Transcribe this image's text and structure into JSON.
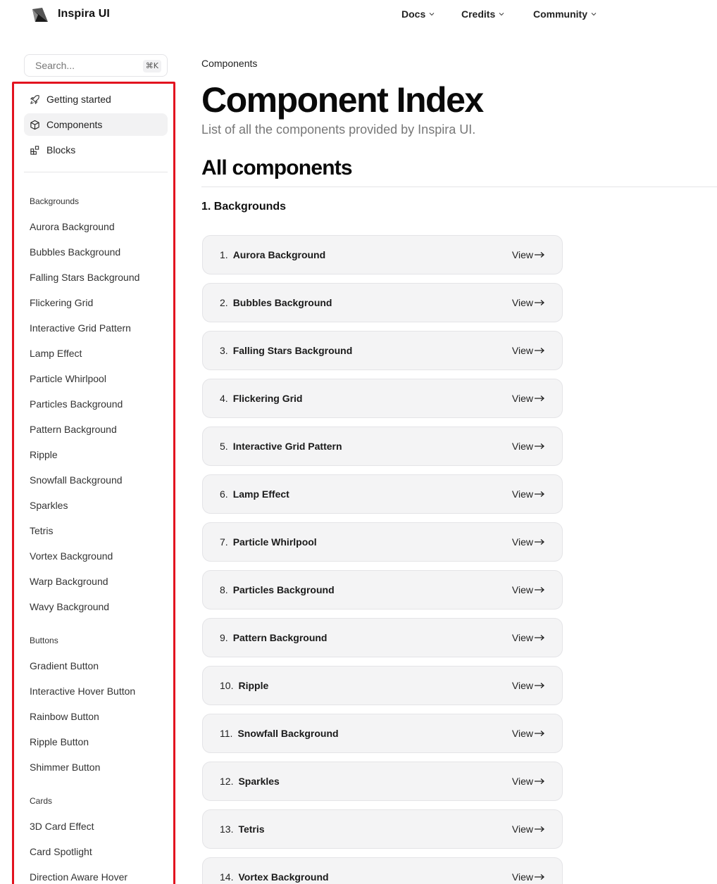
{
  "header": {
    "brand": "Inspira UI",
    "nav": [
      {
        "label": "Docs"
      },
      {
        "label": "Credits"
      },
      {
        "label": "Community"
      }
    ]
  },
  "sidebar": {
    "search": {
      "placeholder": "Search...",
      "shortcut": "⌘K"
    },
    "top_links": [
      {
        "label": "Getting started",
        "icon": "rocket-icon",
        "active": false
      },
      {
        "label": "Components",
        "icon": "cube-icon",
        "active": true
      },
      {
        "label": "Blocks",
        "icon": "blocks-icon",
        "active": false
      }
    ],
    "groups": [
      {
        "title": "Backgrounds",
        "items": [
          "Aurora Background",
          "Bubbles Background",
          "Falling Stars Background",
          "Flickering Grid",
          "Interactive Grid Pattern",
          "Lamp Effect",
          "Particle Whirlpool",
          "Particles Background",
          "Pattern Background",
          "Ripple",
          "Snowfall Background",
          "Sparkles",
          "Tetris",
          "Vortex Background",
          "Warp Background",
          "Wavy Background"
        ]
      },
      {
        "title": "Buttons",
        "items": [
          "Gradient Button",
          "Interactive Hover Button",
          "Rainbow Button",
          "Ripple Button",
          "Shimmer Button"
        ]
      },
      {
        "title": "Cards",
        "items": [
          "3D Card Effect",
          "Card Spotlight",
          "Direction Aware Hover"
        ]
      }
    ]
  },
  "main": {
    "breadcrumb": "Components",
    "title": "Component Index",
    "subtitle": "List of all the components provided by Inspira UI.",
    "section_title": "All components",
    "subsection_title": "1. Backgrounds",
    "view_label": "View",
    "components": [
      {
        "num": "1.",
        "name": "Aurora Background"
      },
      {
        "num": "2.",
        "name": "Bubbles Background"
      },
      {
        "num": "3.",
        "name": "Falling Stars Background"
      },
      {
        "num": "4.",
        "name": "Flickering Grid"
      },
      {
        "num": "5.",
        "name": "Interactive Grid Pattern"
      },
      {
        "num": "6.",
        "name": "Lamp Effect"
      },
      {
        "num": "7.",
        "name": "Particle Whirlpool"
      },
      {
        "num": "8.",
        "name": "Particles Background"
      },
      {
        "num": "9.",
        "name": "Pattern Background"
      },
      {
        "num": "10.",
        "name": "Ripple"
      },
      {
        "num": "11.",
        "name": "Snowfall Background"
      },
      {
        "num": "12.",
        "name": "Sparkles"
      },
      {
        "num": "13.",
        "name": "Tetris"
      },
      {
        "num": "14.",
        "name": "Vortex Background"
      }
    ]
  },
  "colors": {
    "highlight_border": "#e2131f",
    "card_bg": "#f4f4f5",
    "active_bg": "#f2f2f3"
  }
}
